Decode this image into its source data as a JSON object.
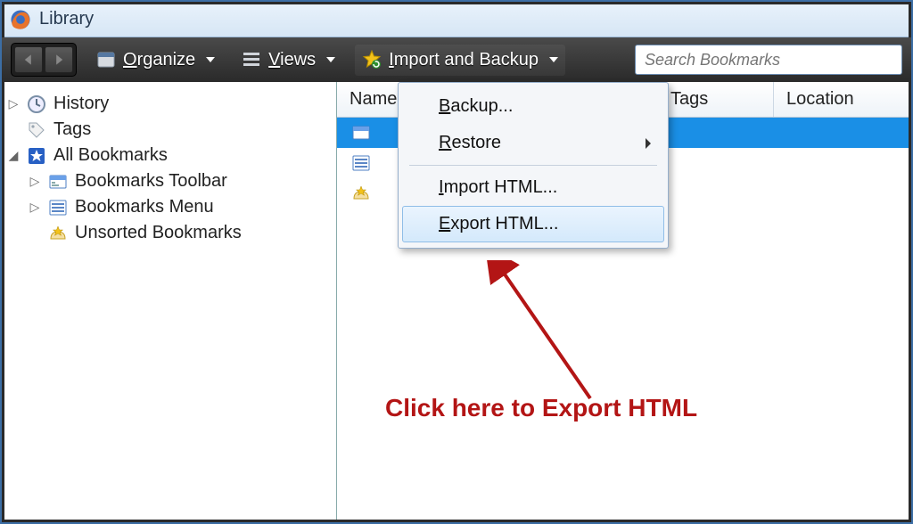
{
  "window": {
    "title": "Library"
  },
  "toolbar": {
    "organize": "Organize",
    "views": "Views",
    "import_backup": "Import and Backup",
    "search_placeholder": "Search Bookmarks"
  },
  "sidebar": {
    "items": [
      {
        "label": "History",
        "icon": "clock-icon",
        "depth": 0,
        "expand": "closed"
      },
      {
        "label": "Tags",
        "icon": "tag-icon",
        "depth": 0,
        "expand": "none"
      },
      {
        "label": "All Bookmarks",
        "icon": "star-icon",
        "depth": 0,
        "expand": "open"
      },
      {
        "label": "Bookmarks Toolbar",
        "icon": "toolbar-icon",
        "depth": 1,
        "expand": "closed"
      },
      {
        "label": "Bookmarks Menu",
        "icon": "menu-icon",
        "depth": 1,
        "expand": "closed"
      },
      {
        "label": "Unsorted Bookmarks",
        "icon": "unsorted-icon",
        "depth": 1,
        "expand": "none"
      }
    ]
  },
  "columns": {
    "name": "Name",
    "tags": "Tags",
    "location": "Location"
  },
  "rows": [
    {
      "icon": "toolbar-icon",
      "selected": true
    },
    {
      "icon": "menu-icon",
      "selected": false
    },
    {
      "icon": "unsorted-icon",
      "selected": false
    }
  ],
  "dropdown": {
    "backup": "Backup...",
    "restore": "Restore",
    "import_html": "Import HTML...",
    "export_html": "Export HTML..."
  },
  "annotation": {
    "text": "Click here to Export HTML"
  }
}
